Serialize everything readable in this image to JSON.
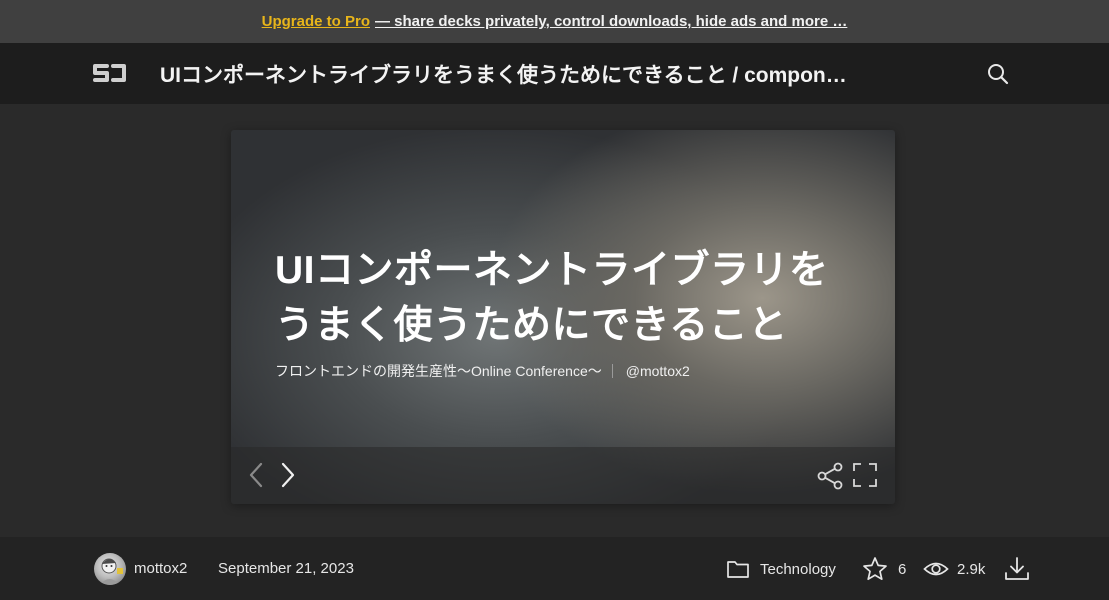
{
  "promo": {
    "link_label": "Upgrade to Pro",
    "message": "— share decks privately, control downloads, hide ads and more …"
  },
  "header": {
    "logo_icon": "speakerdeck-logo-icon",
    "title": "UIコンポーネントライブラリをうまく使うためにできること / compon…",
    "search_icon": "search-icon"
  },
  "slide": {
    "title_line1": "UIコンポーネントライブラリを",
    "title_line2": "うまく使うためにできること",
    "event": "フロントエンドの開発生産性〜Online Conference〜",
    "handle": "@mottox2"
  },
  "controls": {
    "prev_icon": "chevron-left-icon",
    "next_icon": "chevron-right-icon",
    "share_icon": "share-icon",
    "fullscreen_icon": "fullscreen-icon"
  },
  "meta": {
    "author": "mottox2",
    "date": "September 21, 2023",
    "category": "Technology",
    "stars": "6",
    "views": "2.9k"
  },
  "colors": {
    "accent": "#e8b51a",
    "background": "#262626",
    "header": "#1d1d1d",
    "promo": "#404040"
  }
}
